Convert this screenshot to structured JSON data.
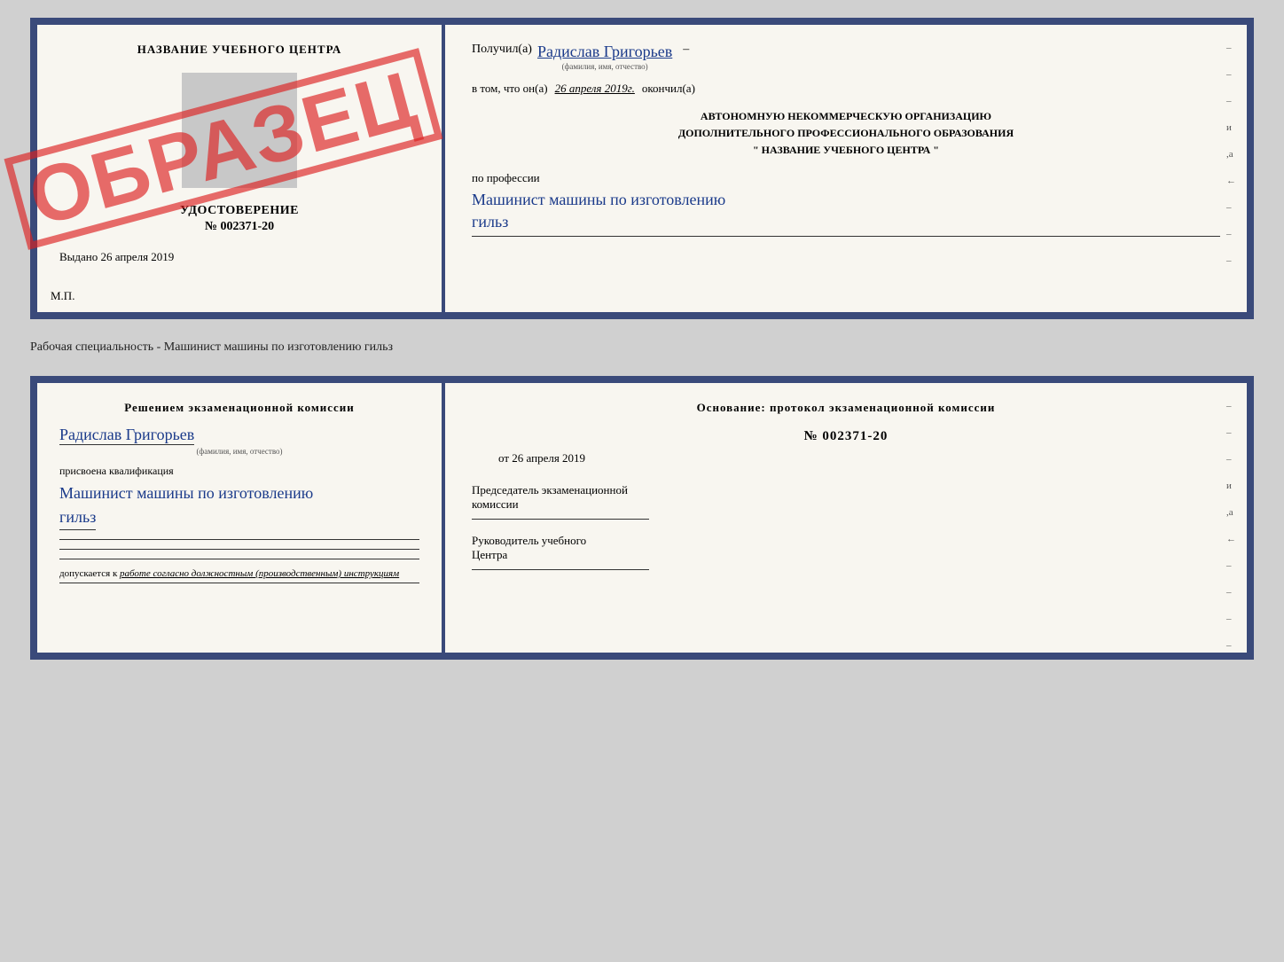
{
  "topCert": {
    "leftPanel": {
      "eduCenterTitle": "НАЗВАНИЕ УЧЕБНОГО ЦЕНТРА",
      "udostoverenie": "УДОСТОВЕРЕНИЕ",
      "number": "№ 002371-20",
      "vydano": "Выдано",
      "vydanoDate": "26 апреля 2019",
      "mp": "М.П.",
      "obrazets": "ОБРАЗЕЦ"
    },
    "rightPanel": {
      "poluchilLabel": "Получил(а)",
      "name": "Радислав Григорьев",
      "nameSubLabel": "(фамилия, имя, отчество)",
      "dashAfterName": "–",
      "vTomLabel": "в том, что он(а)",
      "date": "26 апреля 2019г.",
      "okonchilLabel": "окончил(а)",
      "avtonomnuyuLine1": "АВТОНОМНУЮ НЕКОММЕРЧЕСКУЮ ОРГАНИЗАЦИЮ",
      "avtonomnuyuLine2": "ДОПОЛНИТЕЛЬНОГО ПРОФЕССИОНАЛЬНОГО ОБРАЗОВАНИЯ",
      "nameQuotes": "\" НАЗВАНИЕ УЧЕБНОГО ЦЕНТРА \"",
      "poProfessiiLabel": "по профессии",
      "profession1": "Машинист машины по изготовлению",
      "profession2": "гильз",
      "sideLabels": [
        "–",
        "–",
        "и",
        "а",
        "←",
        "–",
        "–",
        "–"
      ]
    }
  },
  "betweenLabel": "Рабочая специальность - Машинист машины по изготовлению гильз",
  "bottomCert": {
    "leftPanel": {
      "resheniemTitle": "Решением  экзаменационной  комиссии",
      "name": "Радислав Григорьев",
      "nameSubLabel": "(фамилия, имя, отчество)",
      "prisvoenaLabel": "присвоена квалификация",
      "qualification1": "Машинист машины по изготовлению",
      "qualification2": "гильз",
      "dopuskaetsyaLabel": "допускается к",
      "dopuskaetsyaText": "работе согласно должностным (производственным) инструкциям"
    },
    "rightPanel": {
      "osnovanieTitleLine1": "Основание: протокол экзаменационной  комиссии",
      "protocolNumber": "№  002371-20",
      "protocolDatePrefix": "от",
      "protocolDate": "26 апреля 2019",
      "predsedatelLine1": "Председатель экзаменационной",
      "predsedatelLine2": "комиссии",
      "rukovoditelLine1": "Руководитель учебного",
      "rukovoditelLine2": "Центра",
      "sideLabels": [
        "–",
        "–",
        "–",
        "и",
        "а",
        "←",
        "–",
        "–",
        "–",
        "–"
      ]
    }
  }
}
